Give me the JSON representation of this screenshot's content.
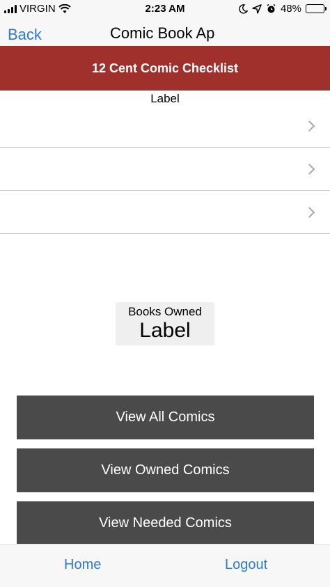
{
  "status_bar": {
    "carrier": "VIRGIN",
    "time": "2:23 AM",
    "battery": "48%",
    "battery_level": 0.48
  },
  "nav": {
    "back_label": "Back",
    "title": "Comic Book Ap"
  },
  "header": {
    "title": "12 Cent Comic Checklist"
  },
  "list": {
    "top_label": "Label"
  },
  "owned": {
    "title": "Books Owned",
    "value": "Label"
  },
  "actions": {
    "view_all": "View All Comics",
    "view_owned": "View Owned Comics",
    "view_needed": "View Needed Comics"
  },
  "tabs": {
    "home": "Home",
    "logout": "Logout"
  },
  "colors": {
    "header_bg": "#a0302b",
    "button_bg": "#4a4a4a",
    "link_blue": "#2f7ad6"
  }
}
